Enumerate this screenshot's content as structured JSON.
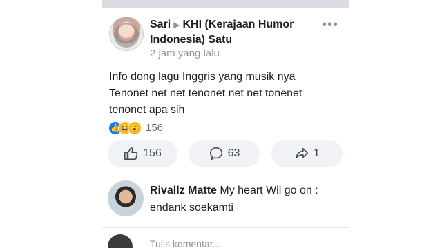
{
  "post": {
    "author": "Sari",
    "group": "KHI (Kerajaan Humor Indonesia) Satu",
    "time": "2 jam yang lalu",
    "text": "Info dong lagu Inggris yang musik nya Tenonet net net tenonet net net tonenet tenonet apa sih",
    "reaction_count": "156"
  },
  "actions": {
    "like_count": "156",
    "comment_count": "63",
    "share_count": "1"
  },
  "comment": {
    "author": "Rivallz Matte",
    "text": "My heart Wil go on : endank soekamti"
  },
  "composer": {
    "placeholder": "Tulis komentar..."
  },
  "icons": {
    "more": "more-horizontal-icon",
    "like": "thumbs-up-icon",
    "comment": "comment-bubble-icon",
    "share": "share-arrow-icon"
  },
  "colors": {
    "like_blue": "#1877f2",
    "reaction_yellow": "#f7b928",
    "button_bg": "#f0f2f5",
    "text_muted": "#8d949e"
  }
}
